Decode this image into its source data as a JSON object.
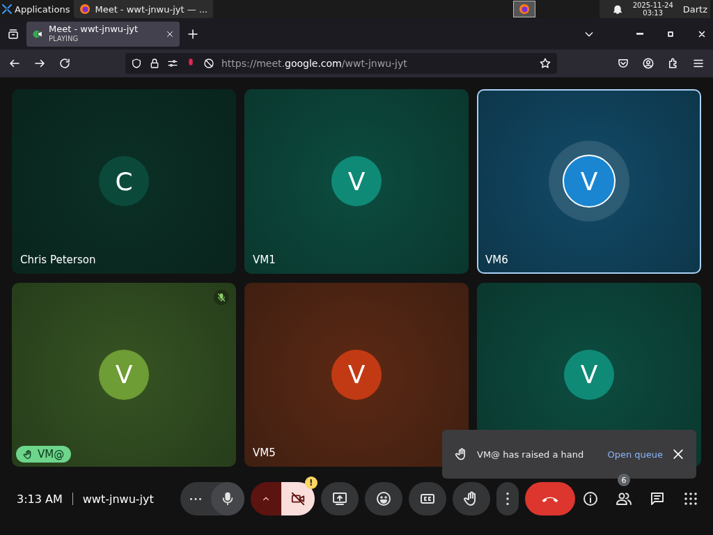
{
  "taskbar": {
    "menu": "Applications",
    "window": "Meet - wwt-jnwu-jyt — ...",
    "date": "2025-11-24",
    "time": "03:13",
    "user": "Dartz"
  },
  "browser": {
    "tab": {
      "title": "Meet - wwt-jnwu-jyt",
      "status": "PLAYING",
      "selected": true
    },
    "url_parts": [
      "https://meet.",
      "google.com",
      "/wwt-jnwu-jyt"
    ]
  },
  "tiles": [
    {
      "initial": "C",
      "name": "Chris Peterson",
      "color": "#0b4a3b",
      "speaking": false,
      "muted": false,
      "hand_raised": false
    },
    {
      "initial": "V",
      "name": "VM1",
      "color": "#0f8a76",
      "speaking": false,
      "muted": false,
      "hand_raised": false
    },
    {
      "initial": "V",
      "name": "VM6",
      "color": "#1a86d1",
      "speaking": true,
      "muted": false,
      "hand_raised": false
    },
    {
      "initial": "V",
      "name": "VM@",
      "color": "#6e9c35",
      "speaking": false,
      "muted": true,
      "hand_raised": true
    },
    {
      "initial": "V",
      "name": "VM5",
      "color": "#c23a14",
      "speaking": false,
      "muted": false,
      "hand_raised": false
    },
    {
      "initial": "V",
      "color": "#0f8a76",
      "speaking": false,
      "muted": false
    }
  ],
  "toast": {
    "message": "VM@ has raised a hand",
    "action": "Open queue"
  },
  "footer": {
    "time": "3:13 AM",
    "meeting_code": "wwt-jnwu-jyt"
  },
  "controls": [
    {
      "kind": "mic",
      "muted": false
    },
    {
      "kind": "camera",
      "on": false,
      "alert": "!"
    },
    {
      "kind": "present"
    },
    {
      "kind": "reactions"
    },
    {
      "kind": "captions"
    },
    {
      "kind": "hand"
    },
    {
      "kind": "more"
    },
    {
      "kind": "end"
    }
  ],
  "side_controls": [
    {
      "kind": "info"
    },
    {
      "kind": "people",
      "badge": "6"
    },
    {
      "kind": "chat"
    },
    {
      "kind": "apps"
    }
  ]
}
